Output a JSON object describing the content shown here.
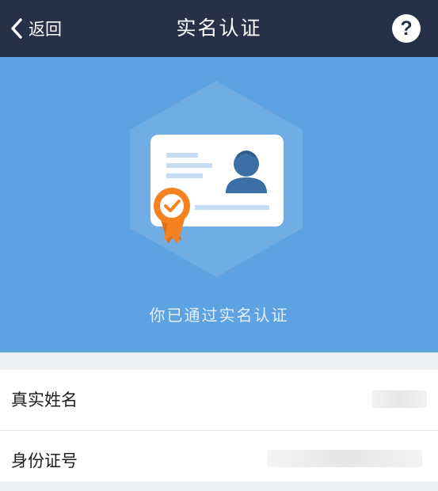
{
  "navbar": {
    "back_label": "返回",
    "title": "实名认证",
    "help_glyph": "?"
  },
  "banner": {
    "status_text": "你已通过实名认证"
  },
  "info_rows": [
    {
      "label": "真实姓名",
      "value": ""
    },
    {
      "label": "身份证号",
      "value": ""
    }
  ],
  "colors": {
    "navbar_bg": "#263046",
    "banner_bg": "#5da2e1",
    "badge_orange": "#f58220",
    "card_bg": "#ffffff"
  },
  "icons": {
    "back": "chevron-left-icon",
    "help": "question-circle-icon",
    "card": "id-card-icon",
    "avatar": "person-avatar-icon",
    "badge": "verified-ribbon-badge-icon"
  }
}
